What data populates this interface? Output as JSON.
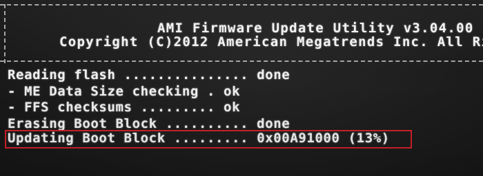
{
  "header": {
    "title": "AMI Firmware Update Utility  v3.04.00",
    "copyright": "Copyright (C)2012 American Megatrends Inc. All Ri"
  },
  "log": [
    {
      "label": "Reading flash",
      "dots": " ............... ",
      "status": "done"
    },
    {
      "label": "- ME Data Size checking",
      "dots": " . ",
      "status": "ok"
    },
    {
      "label": "- FFS checksums",
      "dots": " ......... ",
      "status": "ok"
    },
    {
      "label": "Erasing Boot Block",
      "dots": " .......... ",
      "status": "done"
    },
    {
      "label": "Updating Boot Block",
      "dots": " ......... ",
      "status": "0x00A91000 (13%)"
    }
  ],
  "progress": {
    "percent": 13
  },
  "colors": {
    "background": "#1c1c1c",
    "text": "#f0f0f0",
    "highlight": "#d0202a"
  }
}
